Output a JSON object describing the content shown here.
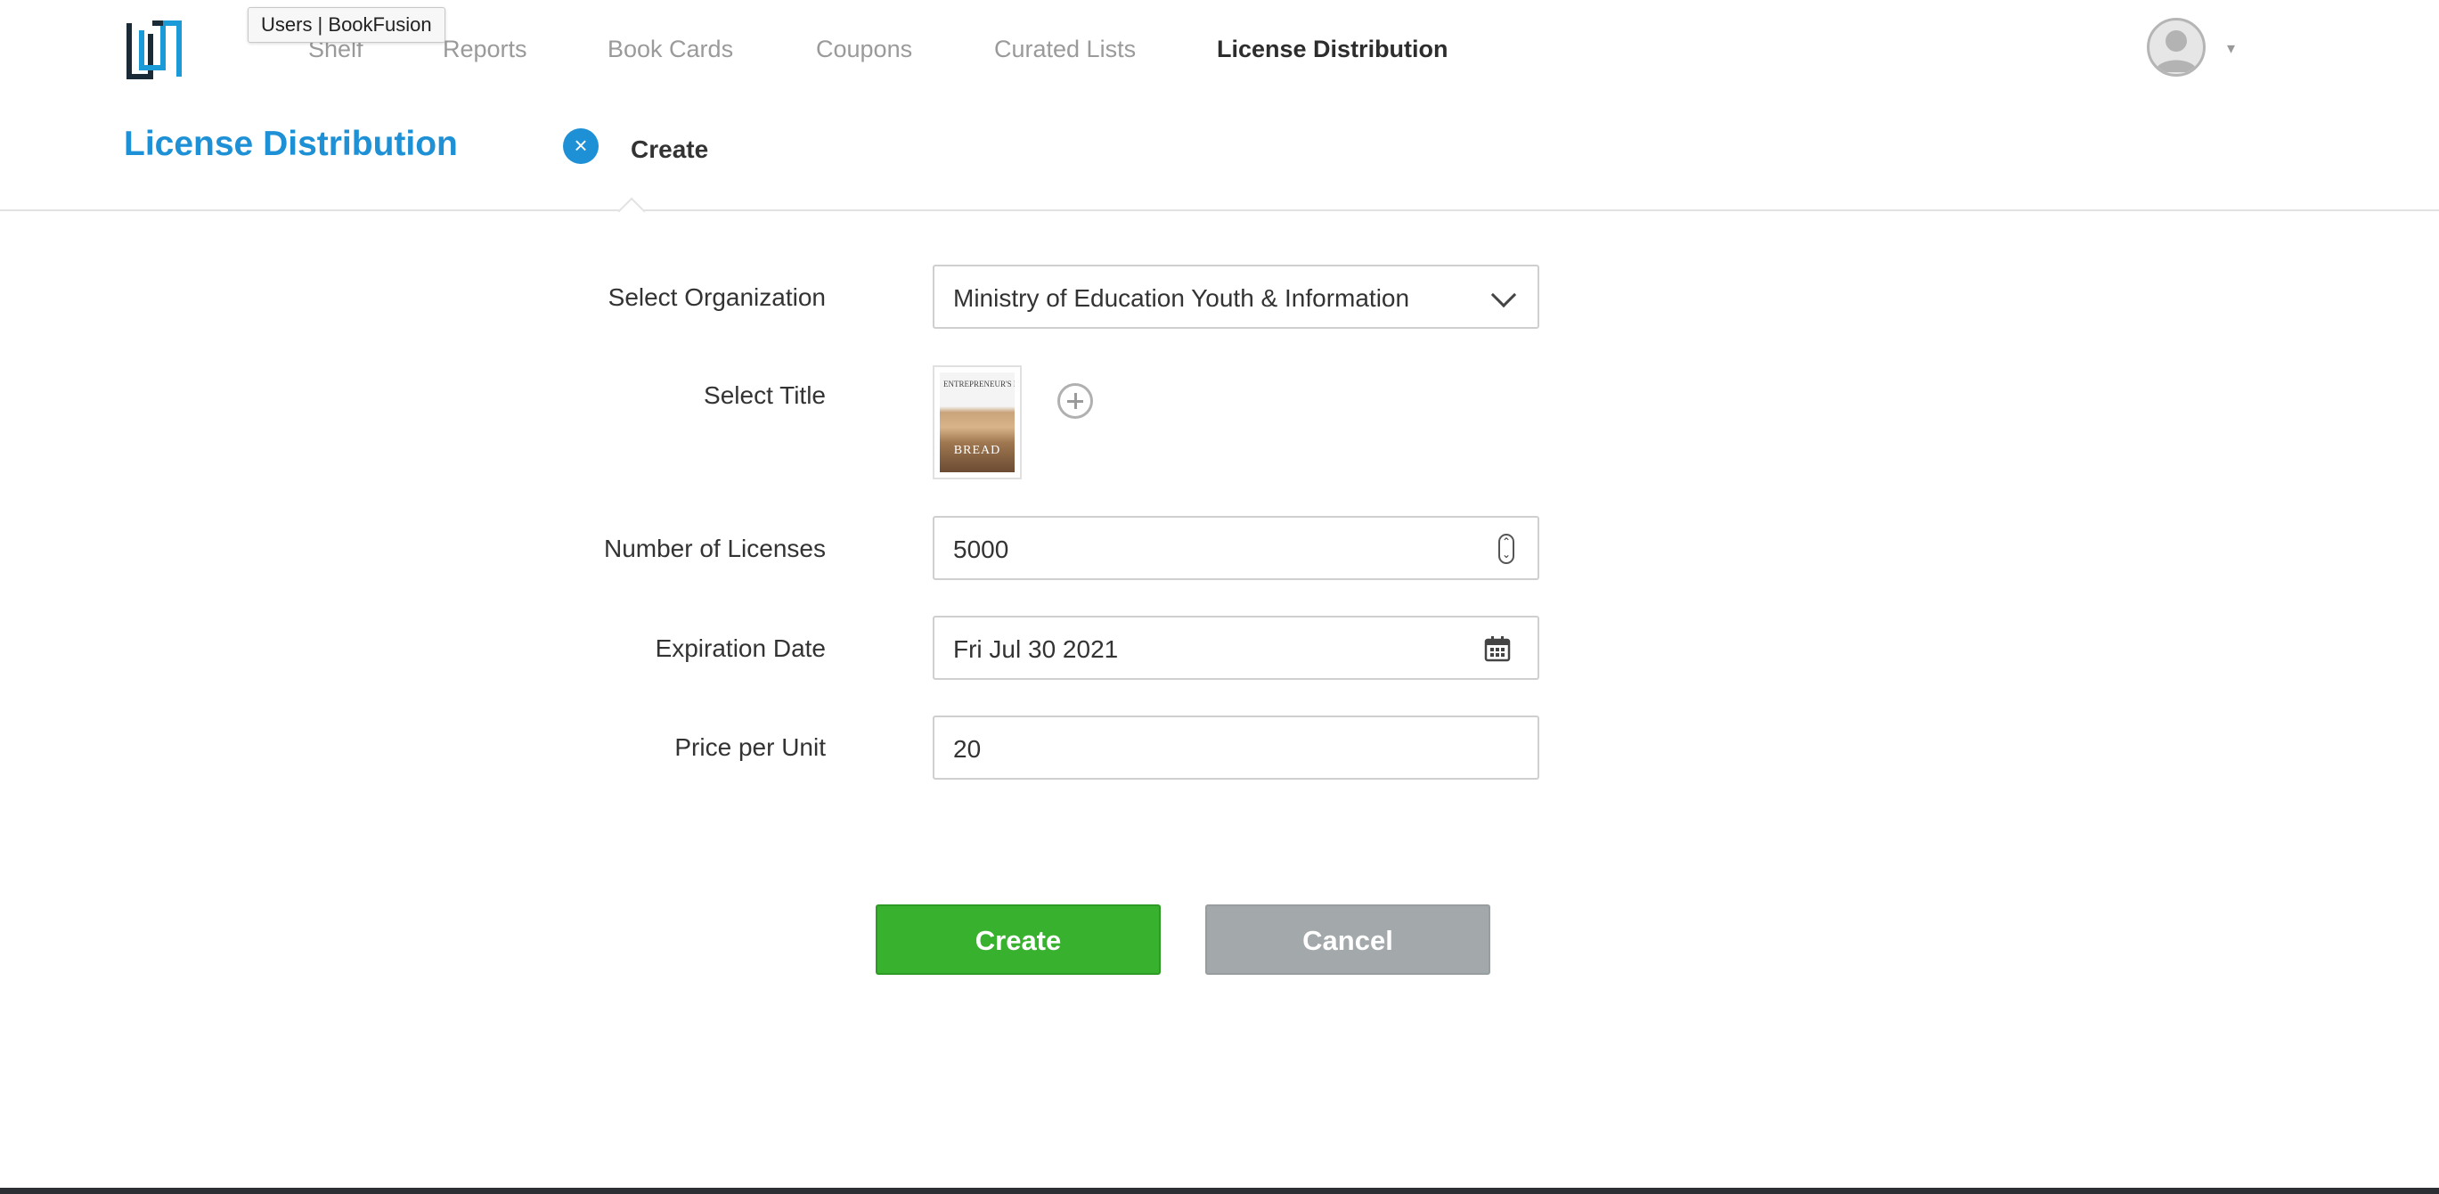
{
  "tooltip": {
    "text": "Users | BookFusion"
  },
  "nav": {
    "items": [
      {
        "label": "Shelf",
        "active": false
      },
      {
        "label": "Reports",
        "active": false
      },
      {
        "label": "Book Cards",
        "active": false
      },
      {
        "label": "Coupons",
        "active": false
      },
      {
        "label": "Curated Lists",
        "active": false
      },
      {
        "label": "License Distribution",
        "active": true
      }
    ],
    "user_menu_caret": "▾"
  },
  "header": {
    "title": "License Distribution",
    "close_icon": "×",
    "breadcrumb": "Create"
  },
  "form": {
    "organization": {
      "label": "Select Organization",
      "value": "Ministry of Education Youth & Information"
    },
    "title": {
      "label": "Select Title",
      "book_cover_text": "ENTREPRENEUR'S LIBRARY",
      "book_cover_band": "BREAD"
    },
    "licenses": {
      "label": "Number of Licenses",
      "value": "5000"
    },
    "expiration": {
      "label": "Expiration Date",
      "value": "Fri Jul 30 2021"
    },
    "price": {
      "label": "Price per Unit",
      "value": "20"
    }
  },
  "actions": {
    "create": "Create",
    "cancel": "Cancel"
  },
  "colors": {
    "brand_blue": "#1e90d6",
    "create_green": "#38b22e",
    "cancel_gray": "#a3a8ab"
  },
  "icons": [
    "bookfusion-logo-icon",
    "avatar-icon",
    "close-icon",
    "chevron-down-icon",
    "spinner-icon",
    "calendar-icon",
    "plus-circle-icon"
  ]
}
